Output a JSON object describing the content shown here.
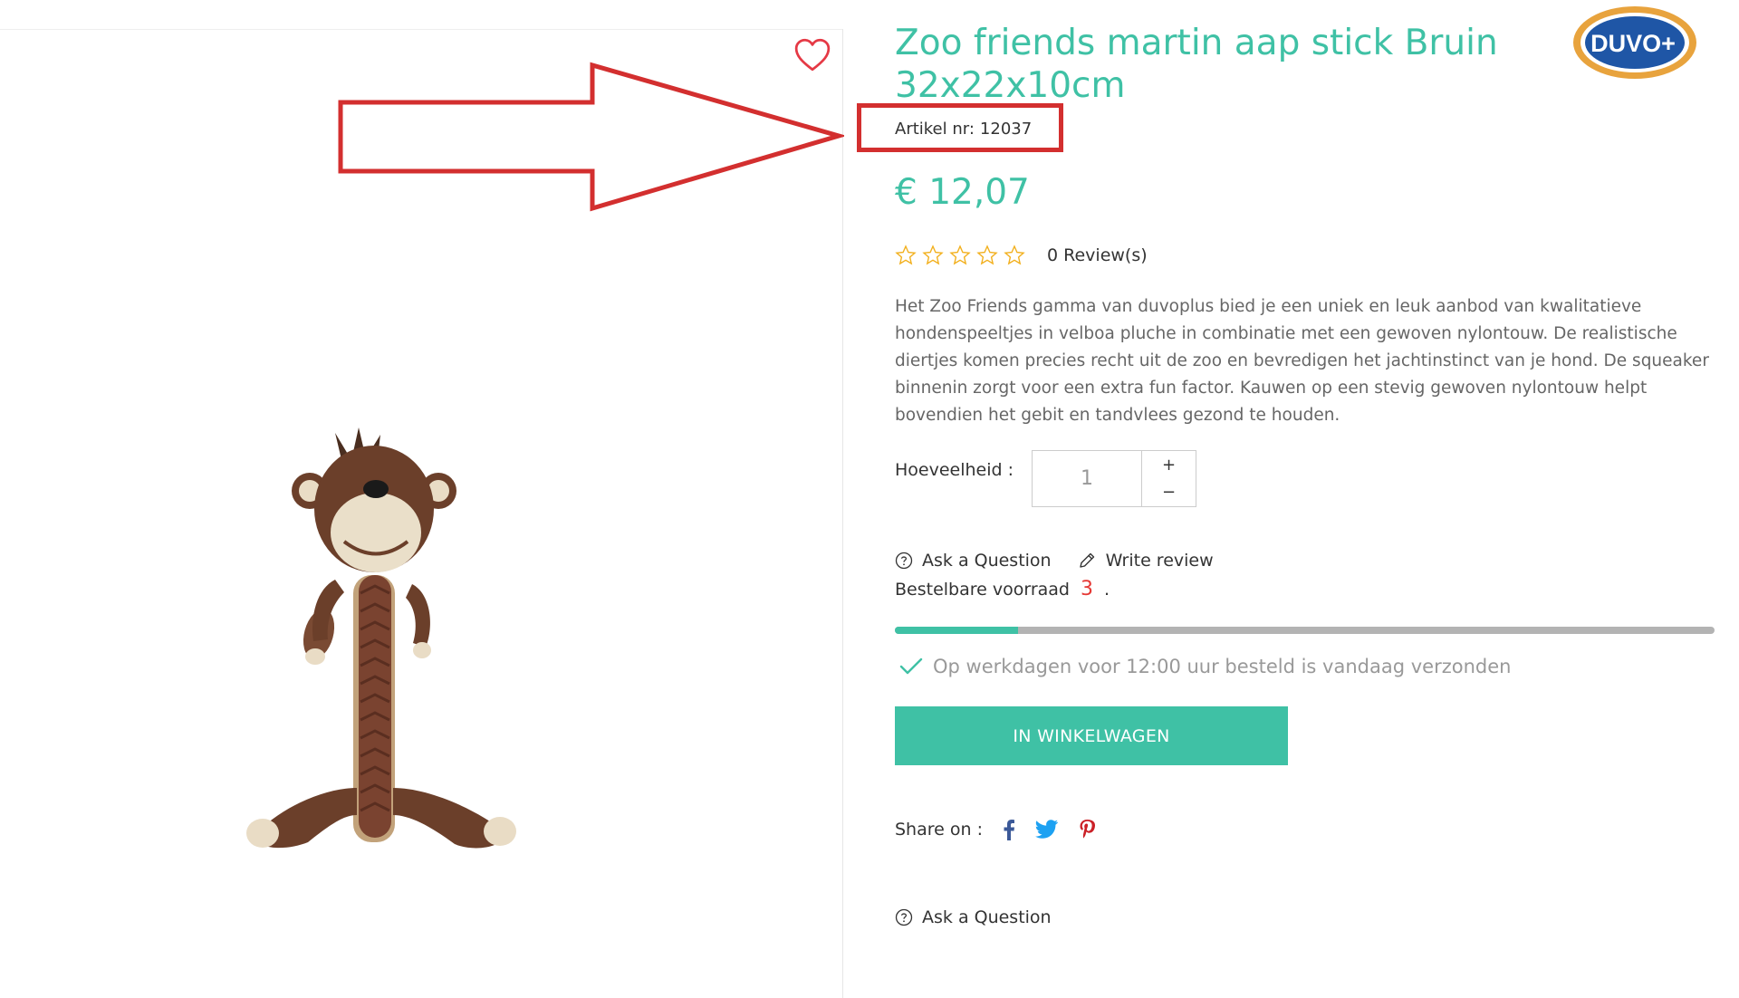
{
  "product": {
    "title": "Zoo friends martin aap stick Bruin 32x22x10cm",
    "sku_label": "Artikel nr:",
    "sku": "12037",
    "price": "€ 12,07",
    "rating": {
      "stars": 0,
      "max": 5,
      "reviews_text": "0 Review(s)"
    },
    "description": "Het Zoo Friends gamma van duvoplus bied je een uniek en leuk aanbod van kwalitatieve hondenspeeltjes in velboa pluche in combinatie met een gewoven nylontouw. De realistische diertjes komen precies recht uit de zoo en bevredigen het jachtinstinct van je hond. De squeaker binnenin zorgt voor een extra fun factor. Kauwen op een stevig gewoven nylontouw helpt bovendien het gebit en tandvlees gezond te houden."
  },
  "brand": {
    "logo_text": "DUVO+"
  },
  "quantity": {
    "label": "Hoeveelheid :",
    "value": "1",
    "plus": "+",
    "minus": "−"
  },
  "actions": {
    "ask_question": "Ask a Question",
    "write_review": "Write review"
  },
  "stock": {
    "label": "Bestelbare voorraad",
    "count": "3",
    "suffix": ".",
    "level": 0.15
  },
  "delivery": {
    "text": "Op werkdagen voor 12:00 uur besteld is vandaag verzonden"
  },
  "cart": {
    "button_label": "IN WINKELWAGEN"
  },
  "share": {
    "label": "Share on :",
    "networks": [
      "facebook-icon",
      "twitter-icon",
      "pinterest-icon"
    ]
  },
  "footer_ask": {
    "label": "Ask a Question"
  },
  "colors": {
    "accent": "#3fc1a5",
    "annotation": "#d32f2f",
    "stock_count": "#e53935",
    "star": "#f2b01e"
  }
}
